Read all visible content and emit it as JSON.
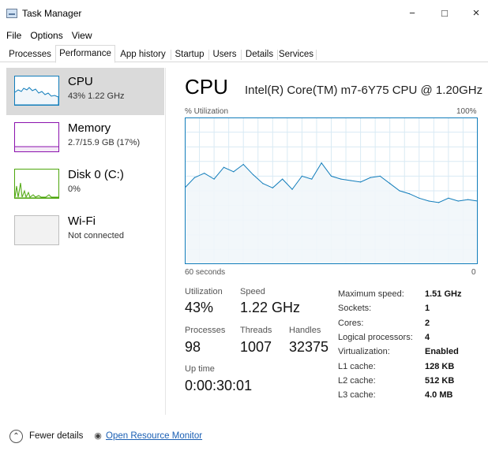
{
  "window": {
    "title": "Task Manager",
    "controls": {
      "minimize": "−",
      "maximize": "□",
      "close": "×"
    }
  },
  "menu": [
    "File",
    "Options",
    "View"
  ],
  "tabs": [
    "Processes",
    "Performance",
    "App history",
    "Startup",
    "Users",
    "Details",
    "Services"
  ],
  "active_tab": "Performance",
  "resources": [
    {
      "name": "CPU",
      "detail": "43%  1.22 GHz",
      "color": "#117dbb",
      "selected": true
    },
    {
      "name": "Memory",
      "detail": "2.7/15.9 GB (17%)",
      "color": "#8b12ae",
      "selected": false
    },
    {
      "name": "Disk 0 (C:)",
      "detail": "0%",
      "color": "#4da60c",
      "selected": false
    },
    {
      "name": "Wi-Fi",
      "detail": "Not connected",
      "color": "#a74f01",
      "selected": false
    }
  ],
  "main": {
    "title": "CPU",
    "subtitle": "Intel(R) Core(TM) m7-6Y75 CPU @ 1.20GHz",
    "util_label": "% Utilization",
    "util_max": "100%",
    "time_label": "60 seconds",
    "time_zero": "0"
  },
  "chart_data": {
    "type": "area",
    "y_label": "% Utilization",
    "ylim": [
      0,
      100
    ],
    "x_label": "60 seconds",
    "x": [
      60,
      58,
      56,
      54,
      52,
      50,
      48,
      46,
      44,
      42,
      40,
      38,
      36,
      34,
      32,
      30,
      28,
      26,
      24,
      22,
      20,
      18,
      16,
      14,
      12,
      10,
      8,
      6,
      4,
      2,
      0
    ],
    "series": [
      {
        "values": [
          52,
          59,
          62,
          58,
          66,
          63,
          68,
          61,
          55,
          52,
          58,
          51,
          60,
          58,
          69,
          60,
          58,
          57,
          56,
          59,
          60,
          55,
          50,
          48,
          45,
          43,
          42,
          45,
          43,
          44,
          43
        ]
      }
    ],
    "fill_color": "#f1f6fa",
    "line_color": "#117dbb",
    "grid_color": "#d9eaf4",
    "grid": true
  },
  "stats": {
    "utilization": {
      "label": "Utilization",
      "value": "43%"
    },
    "speed": {
      "label": "Speed",
      "value": "1.22 GHz"
    },
    "processes": {
      "label": "Processes",
      "value": "98"
    },
    "threads": {
      "label": "Threads",
      "value": "1007"
    },
    "handles": {
      "label": "Handles",
      "value": "32375"
    },
    "uptime": {
      "label": "Up time",
      "value": "0:00:30:01"
    }
  },
  "specs": [
    {
      "key": "Maximum speed:",
      "value": "1.51 GHz"
    },
    {
      "key": "Sockets:",
      "value": "1"
    },
    {
      "key": "Cores:",
      "value": "2"
    },
    {
      "key": "Logical processors:",
      "value": "4"
    },
    {
      "key": "Virtualization:",
      "value": "Enabled"
    },
    {
      "key": "L1 cache:",
      "value": "128 KB"
    },
    {
      "key": "L2 cache:",
      "value": "512 KB"
    },
    {
      "key": "L3 cache:",
      "value": "4.0 MB"
    }
  ],
  "footer": {
    "fewer_details": "Fewer details",
    "open_monitor": "Open Resource Monitor"
  }
}
